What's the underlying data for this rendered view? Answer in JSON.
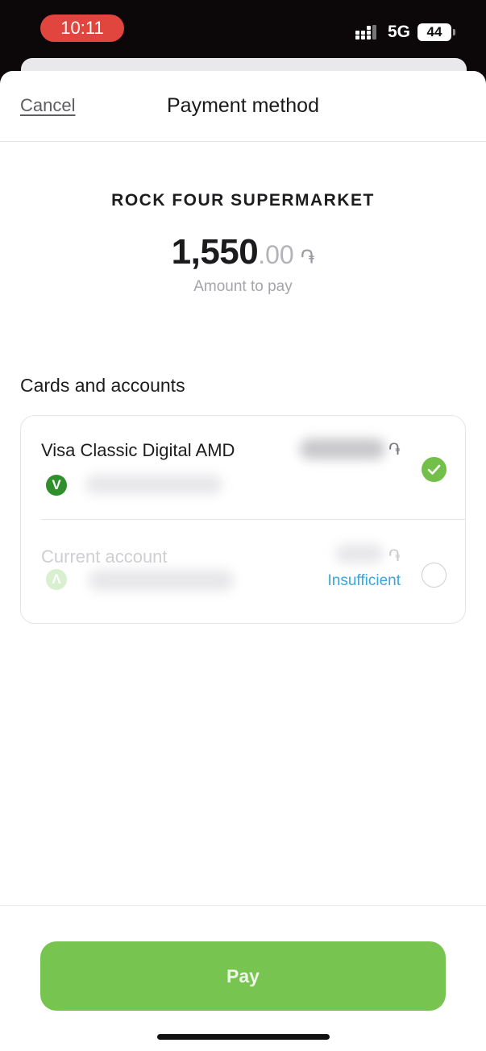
{
  "status_bar": {
    "time": "10:11",
    "network": "5G",
    "battery": "44"
  },
  "header": {
    "cancel_label": "Cancel",
    "title": "Payment method"
  },
  "payment": {
    "merchant": "ROCK FOUR SUPERMARKET",
    "amount_main": "1,550",
    "amount_decimal": ".00",
    "currency_symbol": "֏",
    "amount_caption": "Amount to pay"
  },
  "accounts": {
    "section_title": "Cards and accounts",
    "items": [
      {
        "name": "Visa Classic Digital AMD",
        "currency_symbol": "֏",
        "badge_letter": "V",
        "selected": true,
        "status": ""
      },
      {
        "name": "Current account",
        "currency_symbol": "֏",
        "badge_letter": "Λ",
        "selected": false,
        "status": "Insufficient"
      }
    ]
  },
  "footer": {
    "pay_label": "Pay"
  },
  "colors": {
    "accent_green": "#78c451",
    "check_green": "#72c049",
    "link_blue": "#3aa7d6",
    "record_red": "#e0463e"
  }
}
